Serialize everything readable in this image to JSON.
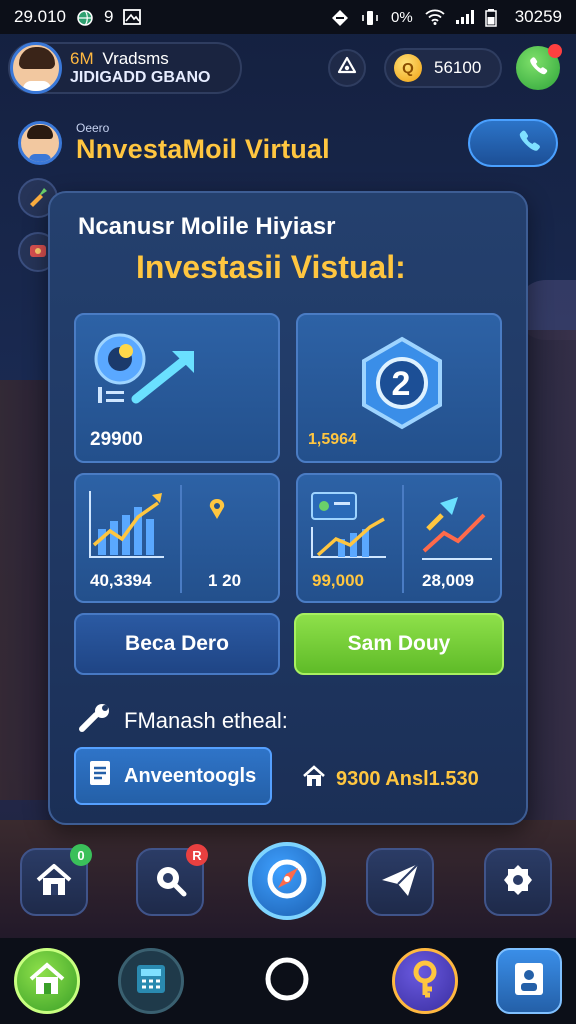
{
  "status_bar": {
    "time": "29.010",
    "left_extra": "9",
    "battery": "30259"
  },
  "header": {
    "level": "6M",
    "player_name": "Vradsms",
    "player_subtitle": "JIDIGADD GBANO",
    "coins": "56100"
  },
  "row2": {
    "small_label": "Oeero",
    "title": "NnvestaMoil Virtual"
  },
  "panel": {
    "heading": "Ncanusr Molile Hiyiasr",
    "title": "Investasii Vistual:",
    "cards": [
      {
        "value": "29900",
        "icon": "chart-trend-icon"
      },
      {
        "value": "1,5964",
        "badge": "2",
        "icon": "gem-badge-icon"
      },
      {
        "value": "40,3394",
        "icon": "bar-growth-icon"
      },
      {
        "value": "1  20",
        "icon": "pin-icon"
      },
      {
        "value": "99,000",
        "icon": "bar-growth-icon"
      },
      {
        "value": "28,009",
        "icon": "arrow-growth-icon"
      }
    ],
    "button_left": "Beca Dero",
    "button_right": "Sam Douy",
    "tool_label": "FManash etheal:",
    "doc_button": "Anveentoogls",
    "house_stat": "9300 Ansl1.530"
  },
  "nav1": {
    "badges": [
      "0",
      "R"
    ]
  },
  "colors": {
    "accent_gold": "#ffc640",
    "panel_blue": "#24406e",
    "button_green": "#6cc830"
  }
}
